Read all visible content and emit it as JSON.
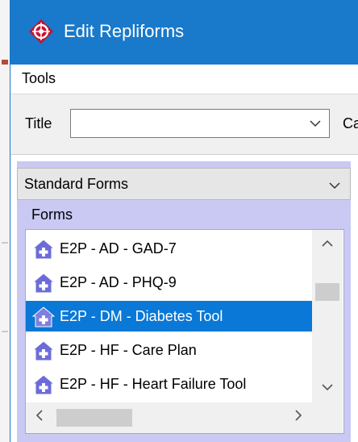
{
  "window": {
    "title": "Edit Repliforms"
  },
  "menubar": {
    "items": [
      "Tools"
    ]
  },
  "toolbar": {
    "title_label": "Title",
    "title_value": "",
    "category_label_partial": "Cat"
  },
  "library": {
    "selected": "Standard Forms",
    "forms_label": "Forms",
    "items": [
      {
        "label": "E2P - AD - GAD-7",
        "selected": false
      },
      {
        "label": "E2P - AD - PHQ-9",
        "selected": false
      },
      {
        "label": "E2P - DM - Diabetes Tool",
        "selected": true
      },
      {
        "label": "E2P - HF - Care Plan",
        "selected": false
      },
      {
        "label": "E2P - HF - Heart Failure Tool",
        "selected": false
      }
    ]
  },
  "icons": {
    "app": "compass-target-icon",
    "form_item": "house-plus-icon",
    "dropdown": "chevron-down-icon"
  },
  "colors": {
    "titlebar": "#1979ca",
    "selection": "#0a78d7",
    "panel": "#c9c9f4",
    "app_icon": "#c8102e"
  }
}
